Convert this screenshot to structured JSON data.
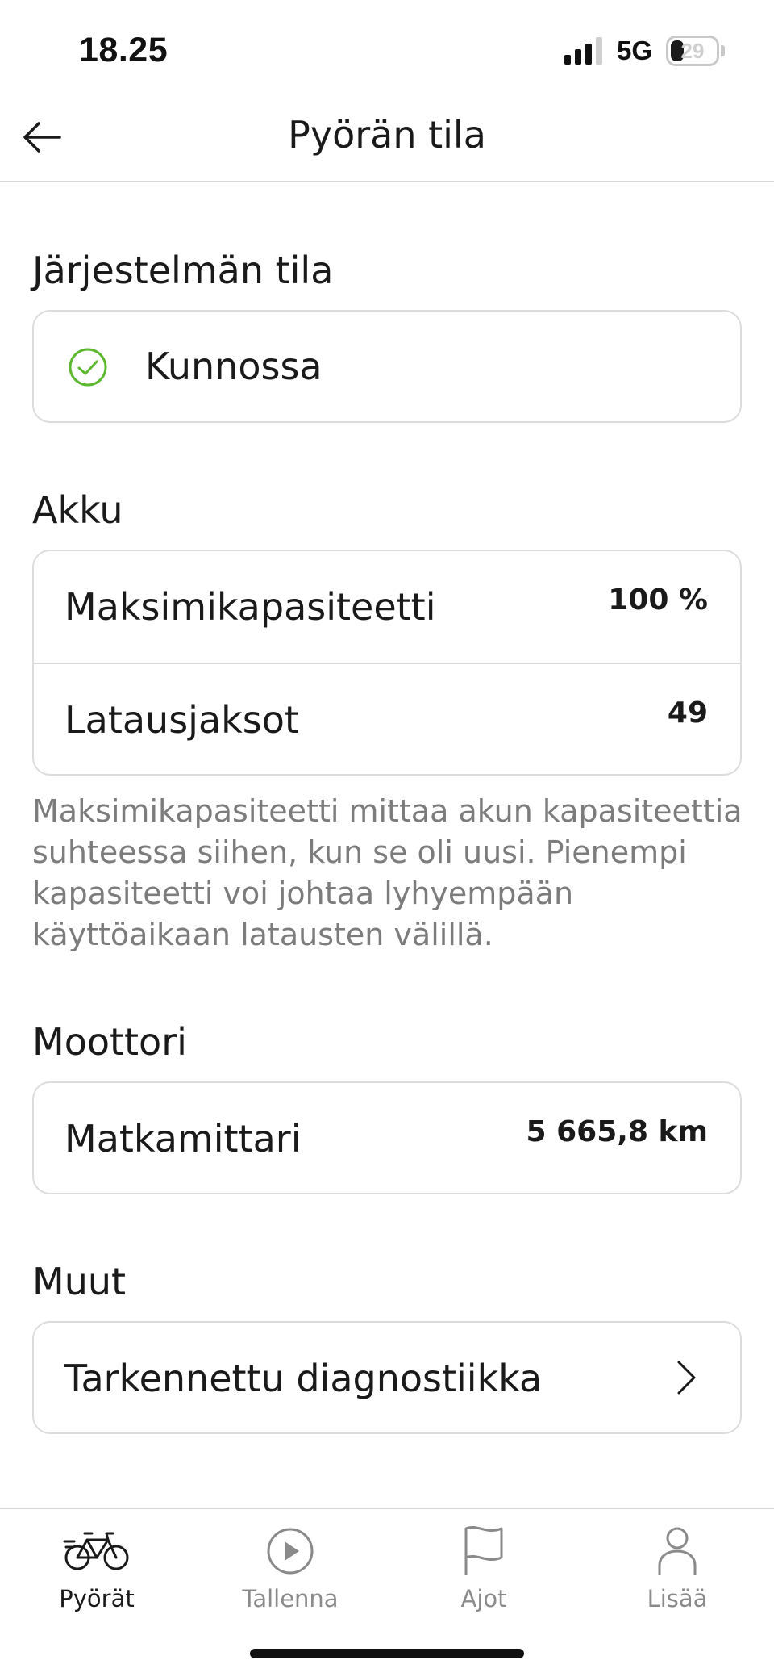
{
  "status_bar": {
    "time": "18.25",
    "network": "5G",
    "battery_level": "29",
    "battery_fraction": 0.29
  },
  "header": {
    "title": "Pyörän tila",
    "back_icon": "arrow-left-icon"
  },
  "system_status": {
    "section_title": "Järjestelmän tila",
    "status_text": "Kunnossa",
    "status_icon": "check-circle-icon",
    "status_color": "#5cb82e"
  },
  "battery": {
    "section_title": "Akku",
    "rows": [
      {
        "label": "Maksimikapasiteetti",
        "value": "100 %"
      },
      {
        "label": "Latausjaksot",
        "value": "49"
      }
    ],
    "description": "Maksimikapasiteetti mittaa akun kapasiteettia suhteessa siihen, kun se oli uusi. Pienempi kapasiteetti voi johtaa lyhyempään käyttöaikaan latausten välillä."
  },
  "motor": {
    "section_title": "Moottori",
    "rows": [
      {
        "label": "Matkamittari",
        "value": "5 665,8 km"
      }
    ]
  },
  "other": {
    "section_title": "Muut",
    "rows": [
      {
        "label": "Tarkennettu diagnostiikka",
        "icon": "chevron-right-icon"
      }
    ]
  },
  "bottom_nav": {
    "items": [
      {
        "label": "Pyörät",
        "icon": "bike-icon",
        "active": true
      },
      {
        "label": "Tallenna",
        "icon": "play-circle-icon",
        "active": false
      },
      {
        "label": "Ajot",
        "icon": "flag-icon",
        "active": false
      },
      {
        "label": "Lisää",
        "icon": "person-icon",
        "active": false
      }
    ]
  }
}
